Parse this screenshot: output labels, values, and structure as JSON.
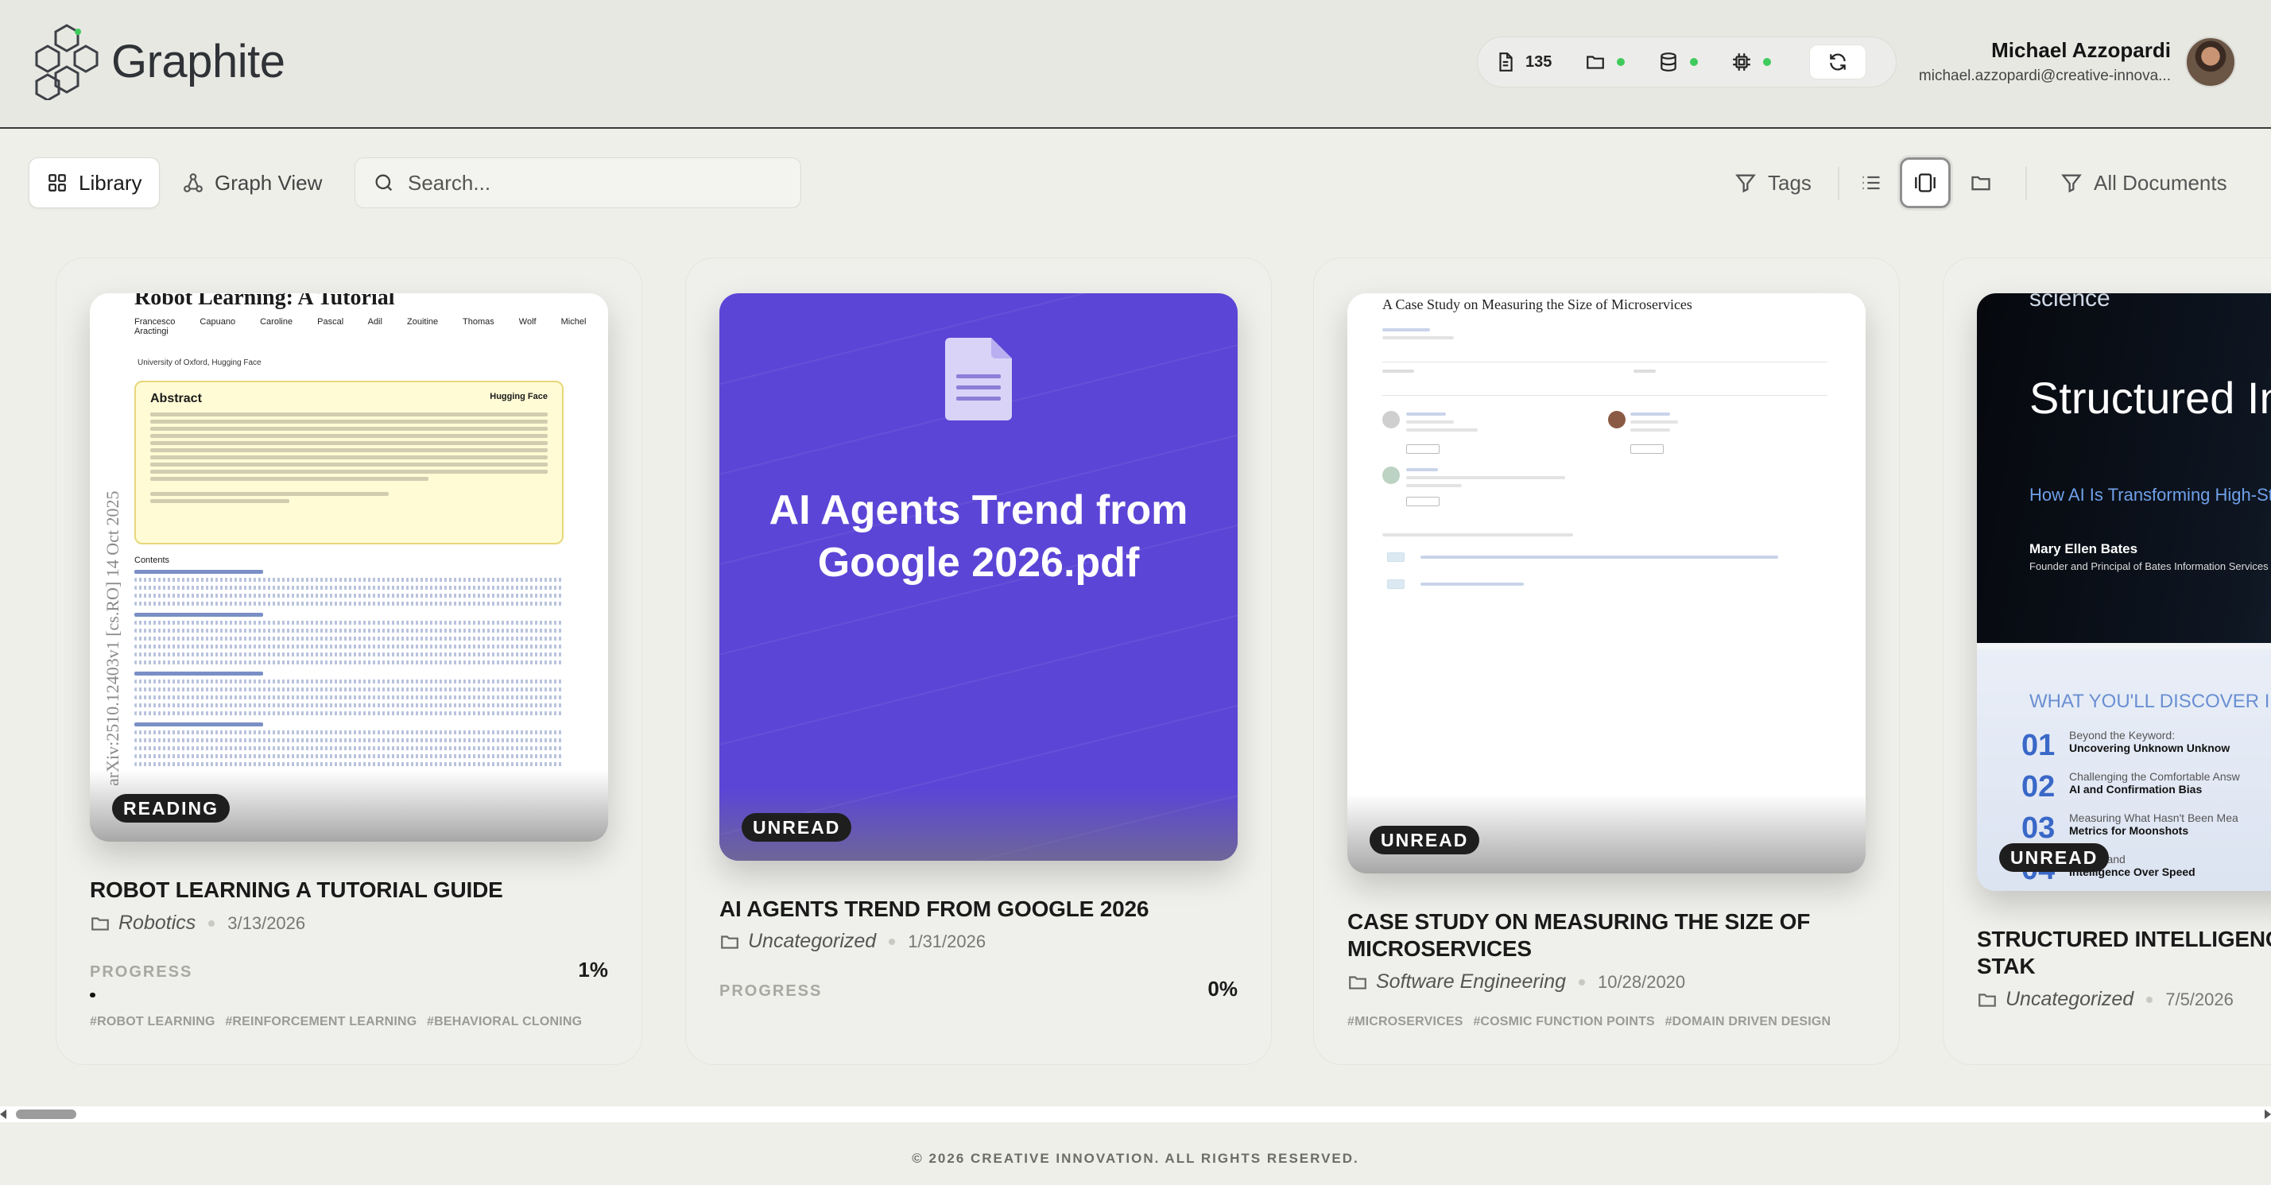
{
  "app": {
    "name": "Graphite",
    "accent_color": "#5b45d6",
    "status_color": "#3ecb5c"
  },
  "header": {
    "stats": {
      "documents_count": "135",
      "documents_icon": "document-icon",
      "folders_icon": "folder-icon",
      "database_icon": "database-icon",
      "processor_icon": "cpu-icon",
      "refresh_icon": "refresh-icon"
    },
    "user": {
      "name": "Michael Azzopardi",
      "email": "michael.azzopardi@creative-innova..."
    }
  },
  "toolbar": {
    "tabs": [
      {
        "label": "Library",
        "active": true,
        "icon": "grid-icon"
      },
      {
        "label": "Graph View",
        "active": false,
        "icon": "graph-icon"
      }
    ],
    "search": {
      "placeholder": "Search...",
      "value": ""
    },
    "tags_label": "Tags",
    "filter_label": "All Documents"
  },
  "documents": [
    {
      "status": "READING",
      "title": "ROBOT LEARNING A TUTORIAL GUIDE",
      "category": "Robotics",
      "date": "3/13/2026",
      "progress_label": "PROGRESS",
      "progress": 1,
      "progress_text": "1%",
      "tags": [
        "#ROBOT LEARNING",
        "#REINFORCEMENT LEARNING",
        "#BEHAVIORAL CLONING"
      ],
      "cover": {
        "title": "Robot Learning: A Tutorial",
        "authors": "Francesco Capuano  Caroline Pascal  Adil Zouitine  Thomas Wolf  Michel Aractingi",
        "affiliations": "University of Oxford,  Hugging Face",
        "arxiv": "arXiv:2510.12403v1  [cs.RO]  14 Oct 2025",
        "abstract_heading": "Abstract",
        "abstract_org": "Hugging Face",
        "contents_heading": "Contents"
      }
    },
    {
      "status": "UNREAD",
      "title": "AI AGENTS TREND FROM GOOGLE 2026",
      "category": "Uncategorized",
      "date": "1/31/2026",
      "progress_label": "PROGRESS",
      "progress": 0,
      "progress_text": "0%",
      "tags": [],
      "cover": {
        "text": "AI Agents Trend from Google 2026.pdf"
      }
    },
    {
      "status": "UNREAD",
      "title": "CASE STUDY ON MEASURING THE SIZE OF MICROSERVICES",
      "category": "Software Engineering",
      "date": "10/28/2020",
      "tags": [
        "#MICROSERVICES",
        "#COSMIC FUNCTION POINTS",
        "#DOMAIN DRIVEN DESIGN"
      ],
      "cover": {
        "title": "A Case Study on Measuring the Size of Microservices"
      }
    },
    {
      "status": "UNREAD",
      "title": "STRUCTURED INTELLIGENC TRANSFORMING HIGH STAK",
      "category": "Uncategorized",
      "date": "7/5/2026",
      "tags": [],
      "cover": {
        "kicker": "science",
        "headline": "Structured Intelligence",
        "subhead": "How AI Is Transforming High-Stakes R&D Decisions",
        "author": "Mary Ellen Bates",
        "role": "Founder and Principal of Bates Information Services",
        "discover": "WHAT YOU'LL DISCOVER INS",
        "items": [
          {
            "num": "01",
            "line1": "Beyond the Keyword:",
            "line2": "Uncovering Unknown Unknow"
          },
          {
            "num": "02",
            "line1": "Challenging the Comfortable Answ",
            "line2": "AI and Confirmation Bias"
          },
          {
            "num": "03",
            "line1": "Measuring What Hasn't Been Mea",
            "line2": "Metrics for Moonshots"
          },
          {
            "num": "04",
            "line1": "...ad AI and",
            "line2": "Intelligence Over Speed"
          }
        ]
      }
    }
  ],
  "footer": {
    "copyright": "© 2026 CREATIVE INNOVATION. ALL RIGHTS RESERVED."
  }
}
